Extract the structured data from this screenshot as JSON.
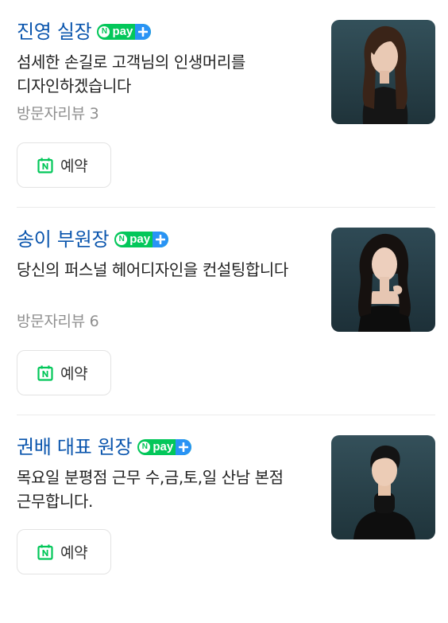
{
  "designers": [
    {
      "name": "진영 실장",
      "npay": {
        "n": "N",
        "text": "pay"
      },
      "description": "섬세한 손길로 고객님의 인생머리를 디자인하겠습니다",
      "review": "방문자리뷰 3",
      "book_label": "예약",
      "photo_subject": "woman-long-hair-black-top"
    },
    {
      "name": "송이 부원장",
      "npay": {
        "n": "N",
        "text": "pay"
      },
      "description": "당신의 퍼스널 헤어디자인을 컨설팅합니다",
      "review": "방문자리뷰 6",
      "book_label": "예약",
      "photo_subject": "woman-long-hair-black-dress"
    },
    {
      "name": "권배 대표 원장",
      "npay": {
        "n": "N",
        "text": "pay"
      },
      "description": "목요일 분평점 근무 수,금,토,일 산남 본점 근무합니다.",
      "review": "",
      "book_label": "예약",
      "photo_subject": "man-short-hair-black-turtleneck"
    }
  ],
  "colors": {
    "name_link": "#0a55ad",
    "npay_green": "#03c75a",
    "npay_plus_blue": "#2993f5",
    "calendar_green": "#03c75a",
    "review_gray": "#8f8f8f"
  },
  "icons": {
    "npay_badge": "npay-plus-icon",
    "booking": "calendar-icon"
  }
}
